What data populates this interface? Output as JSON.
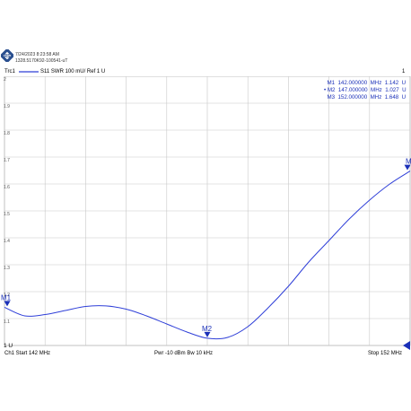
{
  "header": {
    "timestamp": "7/24/2023 8:23:58 AM",
    "instrument": "1328.5170K92-100541-uT"
  },
  "trace_bar": {
    "trace_name": "Trc1",
    "trace_info": "S11  SWR  100 mU/ Ref 1 U",
    "channel_number": "1"
  },
  "markers": [
    {
      "name": "M1",
      "active": false,
      "freq": "142.000000",
      "unit": "MHz",
      "value": "1.142",
      "value_unit": "U"
    },
    {
      "name": "M2",
      "active": true,
      "freq": "147.000000",
      "unit": "MHz",
      "value": "1.027",
      "value_unit": "U"
    },
    {
      "name": "M3",
      "active": false,
      "freq": "152.000000",
      "unit": "MHz",
      "value": "1.648",
      "value_unit": "U"
    }
  ],
  "footer": {
    "start": "Ch1  Start  142 MHz",
    "center": "Pwr  -10 dBm  Bw  10 kHz",
    "stop": "Stop  152 MHz"
  },
  "colors": {
    "trace": "#2f3fd8",
    "marker": "#1a2fb8",
    "grid": "#c8c8c8",
    "text": "#000000"
  },
  "chart_data": {
    "type": "line",
    "title": "",
    "xlabel": "",
    "ylabel": "",
    "x_unit": "MHz",
    "y_unit": "U",
    "xlim": [
      142,
      152
    ],
    "ylim": [
      1.0,
      2.0
    ],
    "yticks": [
      1.0,
      1.1,
      1.2,
      1.3,
      1.4,
      1.5,
      1.6,
      1.7,
      1.8,
      1.9,
      2.0
    ],
    "ytick_labels": [
      "1 U",
      "1.1",
      "1.2",
      "1.3",
      "1.4",
      "1.5",
      "1.6",
      "1.7",
      "1.8",
      "1.9",
      "2"
    ],
    "grid": true,
    "series": [
      {
        "name": "Trc1 S11 SWR",
        "x": [
          142.0,
          142.5,
          143.0,
          143.5,
          144.0,
          144.5,
          145.0,
          145.5,
          146.0,
          146.5,
          147.0,
          147.5,
          148.0,
          148.5,
          149.0,
          149.5,
          150.0,
          150.5,
          151.0,
          151.5,
          152.0
        ],
        "y": [
          1.142,
          1.11,
          1.115,
          1.13,
          1.145,
          1.147,
          1.135,
          1.11,
          1.08,
          1.05,
          1.027,
          1.03,
          1.07,
          1.14,
          1.22,
          1.31,
          1.39,
          1.47,
          1.54,
          1.6,
          1.648
        ]
      }
    ],
    "markers": [
      {
        "name": "M1",
        "x": 142,
        "y": 1.142
      },
      {
        "name": "M2",
        "x": 147,
        "y": 1.027
      },
      {
        "name": "M3",
        "x": 152,
        "y": 1.648
      }
    ],
    "ref_marker": {
      "value": 1.0,
      "side": "right"
    }
  }
}
